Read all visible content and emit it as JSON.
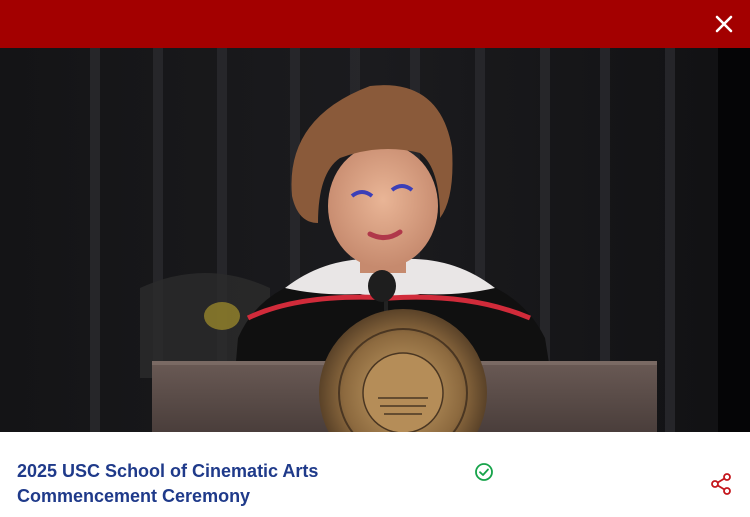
{
  "header": {
    "close_icon": "close-icon",
    "bar_color": "#a30000"
  },
  "video": {
    "alt": "Speaker in academic regalia at a podium with a university seal"
  },
  "info": {
    "title_line1": "2025 USC School of Cinematic Arts",
    "title_line2": "Commencement Ceremony",
    "title_color": "#1f3a8a",
    "verified_icon": "check-circle-icon",
    "verified_color": "#16a34a",
    "share_icon": "share-icon"
  }
}
